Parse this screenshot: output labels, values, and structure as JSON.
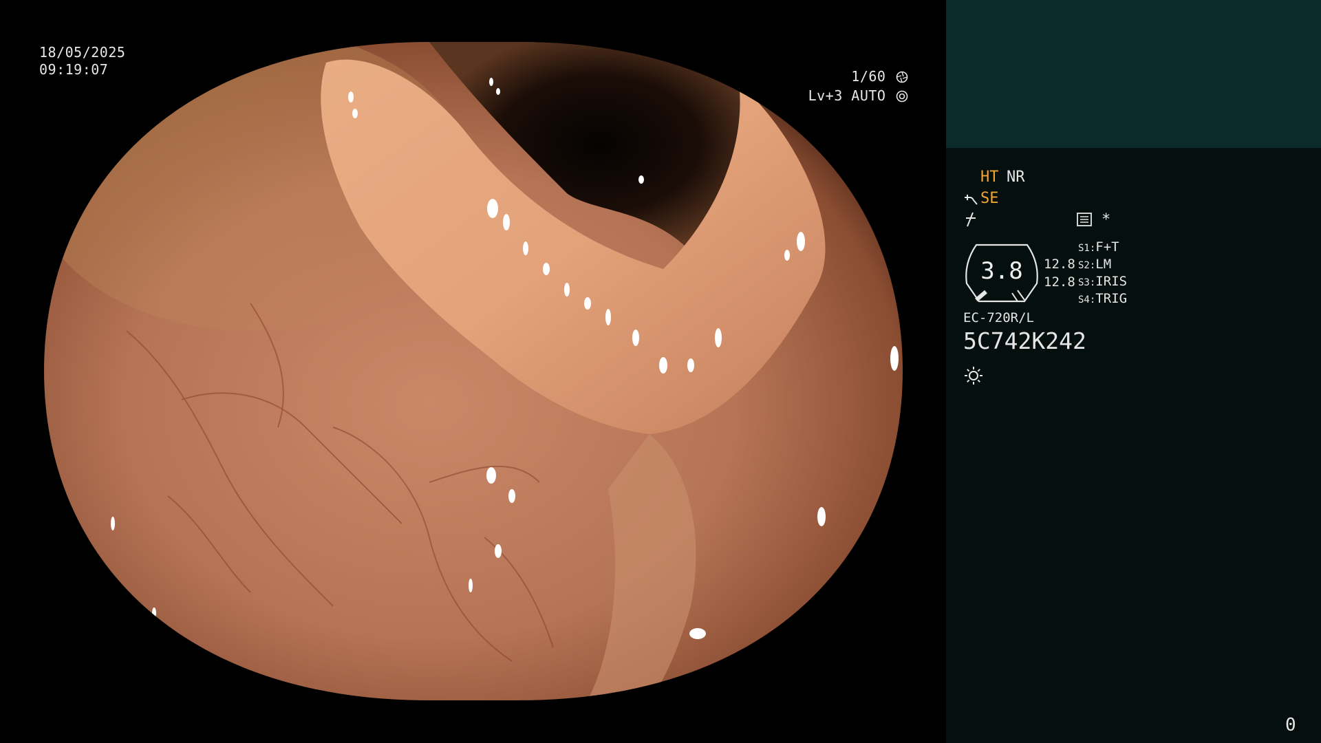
{
  "overlay": {
    "date": "18/05/2025",
    "time": "09:19:07",
    "shutter_speed": "1/60",
    "shutter_icon": "aperture-icon",
    "level_mode": "Lv+3 AUTO",
    "auto_icon": "iris-icon"
  },
  "panel": {
    "ht_label": "HT",
    "nr_label": "NR",
    "se_label": "SE",
    "se_icon": "enhancement-curve-icon",
    "mode_icon": "gamma-icon",
    "menu_icon": "menu-list-icon",
    "asterisk": "*",
    "zoom": {
      "value": "3.8",
      "top_value": "12.8",
      "bottom_value": "12.8"
    },
    "switches": [
      {
        "key": "S1:",
        "value": "F+T"
      },
      {
        "key": "S2:",
        "value": "LM"
      },
      {
        "key": "S3:",
        "value": "IRIS"
      },
      {
        "key": "S4:",
        "value": "TRIG"
      }
    ],
    "scope_model": "EC-720R/L",
    "scope_serial": "5C742K242",
    "light_icon": "light-source-icon",
    "counter": "0"
  },
  "colors": {
    "highlight_orange": "#f2a631",
    "panel_header": "#0b2b2b",
    "panel_body": "#040f0e",
    "osd_text": "#e8e8e8"
  }
}
